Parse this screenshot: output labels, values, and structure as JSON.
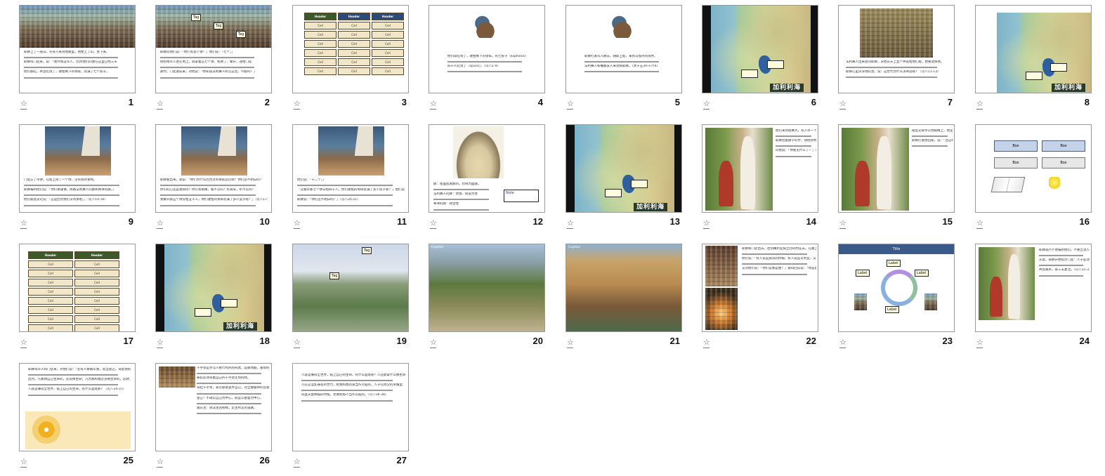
{
  "slides": [
    {
      "n": "1",
      "text": [
        "耶稣上了一座山，许多人来到他那里，他便上了山，坐下来。",
        "耶稣叫门徒来，说：「我怜悯这众人，因为他们同我在这里已经三天",
        "他们都吃，并且吃饱了，收拾剩下的零碎，装满了七个筐子。"
      ]
    },
    {
      "n": "2",
      "text": [
        "耶稣问他们说：「你们有多少饼？」他们说：「七个。」",
        "他吩咐众人坐在地上，就拿着这七个饼，祝谢了，擘开，递给门徒",
        "那时，门徒进前来，对他说：「你知道法利赛人听见这话，不服吗？」"
      ],
      "tags": [
        "Tag",
        "Tag",
        "Tag"
      ]
    },
    {
      "n": "3",
      "table": {
        "head": [
          "Header",
          "Header",
          "Header"
        ],
        "rows": [
          [
            "Cell",
            "Cell",
            "Cell"
          ],
          [
            "Cell",
            "Cell",
            "Cell"
          ],
          [
            "Cell",
            "Cell",
            "Cell"
          ],
          [
            "Cell",
            "Cell",
            "Cell"
          ],
          [
            "Cell",
            "Cell",
            "Cell"
          ],
          [
            "Cell",
            "Cell",
            "Cell"
          ]
        ]
      }
    },
    {
      "n": "4",
      "text": [
        "他们就吃饱了，收拾剩下的零碎，有七筐子（kophinos）",
        "四千人吃饱了（spuris）。（可八1-9）"
      ]
    },
    {
      "n": "5",
      "text": [
        "耶稣打发众人散去，随即上船，来到马加丹的境界。",
        "法利赛人和撒都该人来试探耶稣。（太十五39-十六4）"
      ]
    },
    {
      "n": "6",
      "banner": "加利利海"
    },
    {
      "n": "7",
      "text": [
        "法利赛人出来盘问耶稣，求他从天上显个神迹给他们看，想要试探他。",
        "耶稣心里深深地叹息，说：这世代为什么求神迹呢？（可八11-13）"
      ]
    },
    {
      "n": "8",
      "banner": "加利利海"
    },
    {
      "n": "9",
      "text": [
        "门徒忘了带饼，在船上除了一个饼，没有别的食物。",
        "耶稣嘱咐他们说：「你们要谨慎，防备法利赛人的酵和希律的酵。」",
        "他们彼此议论说：「这是因为我们没有饼吧。」（可八14-16）"
      ]
    },
    {
      "n": "10",
      "text": [
        "耶稣看出来，就说：「你们为什么因为没有饼就议论呢？你们还不明白吗？",
        "你们的心还是愚顽吗？你们有眼睛，看不见吗？有耳朵，听不见吗？",
        "我擘开那五个饼分给五千人，你们收拾的零碎装满了多少篮子呢？」（可八17-19）"
      ]
    },
    {
      "n": "11",
      "text": [
        "他们说：「十二个。」",
        "「又擘开那七个饼分给四千人，你们收拾的零碎装满了多少筐子呢？」他们说：「七个。」",
        "耶稣说：「你们还不明白吗？」（可八20-21）"
      ]
    },
    {
      "n": "12",
      "text": [
        "酵：使面团发酵的，也称为面酵。",
        "法利赛人的酵：伪善、假冒为善",
        "希律的酵：政治性"
      ],
      "note": "Note"
    },
    {
      "n": "13",
      "banner": "加利利海"
    },
    {
      "n": "14",
      "text": [
        "他们来到伯赛大，有人带一个瞎子来，求耶稣摸他。",
        "耶稣拉着瞎子的手，领他到村外，就吐唾沫在他眼睛上，按手在他身上",
        "问他说：「你看见什么了？」（可八22-26）"
      ]
    },
    {
      "n": "15",
      "text": [
        "随后又按手在他眼睛上，他定睛一看，就复了原，样样都看得清楚了。",
        "耶稣打发他回家，说：「连这村子你也不要进去。」（可八25-26）"
      ]
    },
    {
      "n": "16",
      "boxes": [
        "Box",
        "Box",
        "Box",
        "Box"
      ]
    },
    {
      "n": "17",
      "table": {
        "head": [
          "Header",
          "Header"
        ],
        "rows": [
          [
            "Cell",
            "Cell"
          ],
          [
            "Cell",
            "Cell"
          ],
          [
            "Cell",
            "Cell"
          ],
          [
            "Cell",
            "Cell"
          ],
          [
            "Cell",
            "Cell"
          ],
          [
            "Cell",
            "Cell"
          ],
          [
            "Cell",
            "Cell"
          ],
          [
            "Cell",
            "Cell"
          ]
        ]
      }
    },
    {
      "n": "18",
      "banner": "加利利海"
    },
    {
      "n": "19",
      "tags": [
        "Tag",
        "Tag"
      ]
    },
    {
      "n": "20",
      "caption": "Caption"
    },
    {
      "n": "21",
      "caption": "Caption"
    },
    {
      "n": "22",
      "text": [
        "耶稣和门徒出去，往凯撒利亚腓立比的村庄去。在路上问门徒说：「人说我是谁？」",
        "他们说：「有人说是施洗的约翰，有人说是以利亚，又有人说是先知里的一位。」",
        "又问他们说：「你们说我是谁？」彼得回答说：「你是基督。」（可八27-30）"
      ]
    },
    {
      "n": "23",
      "title": "Title",
      "labels": [
        "Label",
        "Label",
        "Label",
        "Label"
      ]
    },
    {
      "n": "24",
      "text": [
        "耶稣就严严地嘱咐他们，不要告诉人。",
        "从此，耶稣开始指示门徒：人子必须受许多的苦，被长老、祭司长和文士弃绝",
        "并且被杀，第三天复活。（可八31-33）"
      ]
    },
    {
      "n": "25",
      "text": [
        "耶稣叫众人和门徒来，对他们说：「若有人要跟从我，就当舍己，背起他的十字架来跟从我。",
        "因为，凡要救自己生命的，必丧掉生命；凡为我和福音丧掉生命的，必救了生命。",
        "人就是赚得全世界，赔上自己的生命，有什么益处呢？（可八34-37）"
      ]
    },
    {
      "n": "26",
      "text": [
        "十字架是罗马人执行死刑的刑具，是最残酷、羞辱的刑罚。",
        "罪犯必须背着自己的十字架走到刑场。",
        "背起十字架，表示愿意舍弃自己，完全顺服神的旨意。",
        "舍己：不再以自己为中心，而是以基督为中心。",
        "跟从主：效法主的榜样，走主所走的道路。"
      ]
    },
    {
      "n": "27",
      "text": [
        "人就是赚得全世界，赔上自己的生命，有什么益处呢？人还能拿什么换生命呢？",
        "凡在这淫乱罪恶的世代，把我和我的道当作可耻的，人子在他父的荣耀里",
        "同圣天使降临的时候，也要把那人当作可耻的。（可八36-38）"
      ]
    }
  ]
}
